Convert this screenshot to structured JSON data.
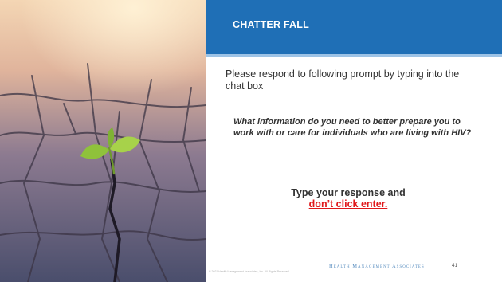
{
  "slide": {
    "title": "CHATTER FALL",
    "instruction": "Please respond to following prompt by typing into the chat box",
    "prompt": "What information do you need to better prepare you to work with or care for individuals who are living with HIV?",
    "cta_line1": "Type your response and",
    "cta_line2": "don’t click enter.",
    "footer_copyright": "© 2021 Health Management Associates, Inc. All Rights Reserved.",
    "footer_brand": "Health Management Associates",
    "page_number": "41"
  },
  "image": {
    "icon": "seedling-in-cracked-earth-photo"
  },
  "colors": {
    "header": "#1f6fb6",
    "header_rule": "#9dc3e6",
    "text": "#333333",
    "warning": "#e0181b",
    "brand": "#5b8fc0"
  }
}
